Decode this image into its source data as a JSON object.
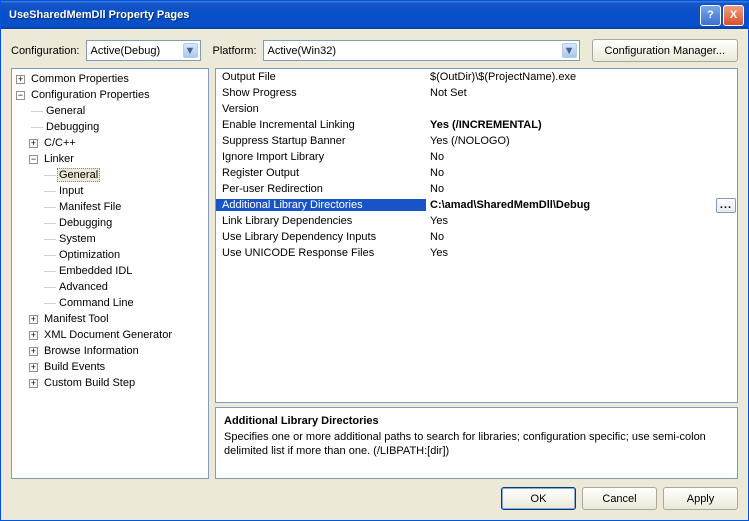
{
  "window": {
    "title": "UseSharedMemDll Property Pages"
  },
  "toprow": {
    "config_label": "Configuration:",
    "config_value": "Active(Debug)",
    "platform_label": "Platform:",
    "platform_value": "Active(Win32)",
    "config_mgr": "Configuration Manager..."
  },
  "tree": {
    "common": "Common Properties",
    "configprops": "Configuration Properties",
    "general": "General",
    "debugging": "Debugging",
    "ccpp": "C/C++",
    "linker": "Linker",
    "linker_general": "General",
    "linker_input": "Input",
    "linker_manifest": "Manifest File",
    "linker_debugging": "Debugging",
    "linker_system": "System",
    "linker_optim": "Optimization",
    "linker_embedidl": "Embedded IDL",
    "linker_advanced": "Advanced",
    "linker_cmdline": "Command Line",
    "manifest_tool": "Manifest Tool",
    "xml_doc": "XML Document Generator",
    "browse_info": "Browse Information",
    "build_events": "Build Events",
    "custom_build": "Custom Build Step"
  },
  "props": [
    {
      "name": "Output File",
      "value": "$(OutDir)\\$(ProjectName).exe"
    },
    {
      "name": "Show Progress",
      "value": "Not Set"
    },
    {
      "name": "Version",
      "value": ""
    },
    {
      "name": "Enable Incremental Linking",
      "value": "Yes (/INCREMENTAL)",
      "bold": true
    },
    {
      "name": "Suppress Startup Banner",
      "value": "Yes (/NOLOGO)"
    },
    {
      "name": "Ignore Import Library",
      "value": "No"
    },
    {
      "name": "Register Output",
      "value": "No"
    },
    {
      "name": "Per-user Redirection",
      "value": "No"
    },
    {
      "name": "Additional Library Directories",
      "value": "C:\\amad\\SharedMemDll\\Debug",
      "selected": true,
      "bold": true
    },
    {
      "name": "Link Library Dependencies",
      "value": "Yes"
    },
    {
      "name": "Use Library Dependency Inputs",
      "value": "No"
    },
    {
      "name": "Use UNICODE Response Files",
      "value": "Yes"
    }
  ],
  "desc": {
    "title": "Additional Library Directories",
    "text": "Specifies one or more additional paths to search for libraries; configuration specific; use semi-colon delimited list if more than one.     (/LIBPATH:[dir])"
  },
  "buttons": {
    "ok": "OK",
    "cancel": "Cancel",
    "apply": "Apply"
  },
  "icons": {
    "plus": "+",
    "minus": "−",
    "ellipsis": "...",
    "dots": "······",
    "dropdown": "▼",
    "help": "?",
    "close": "X"
  }
}
